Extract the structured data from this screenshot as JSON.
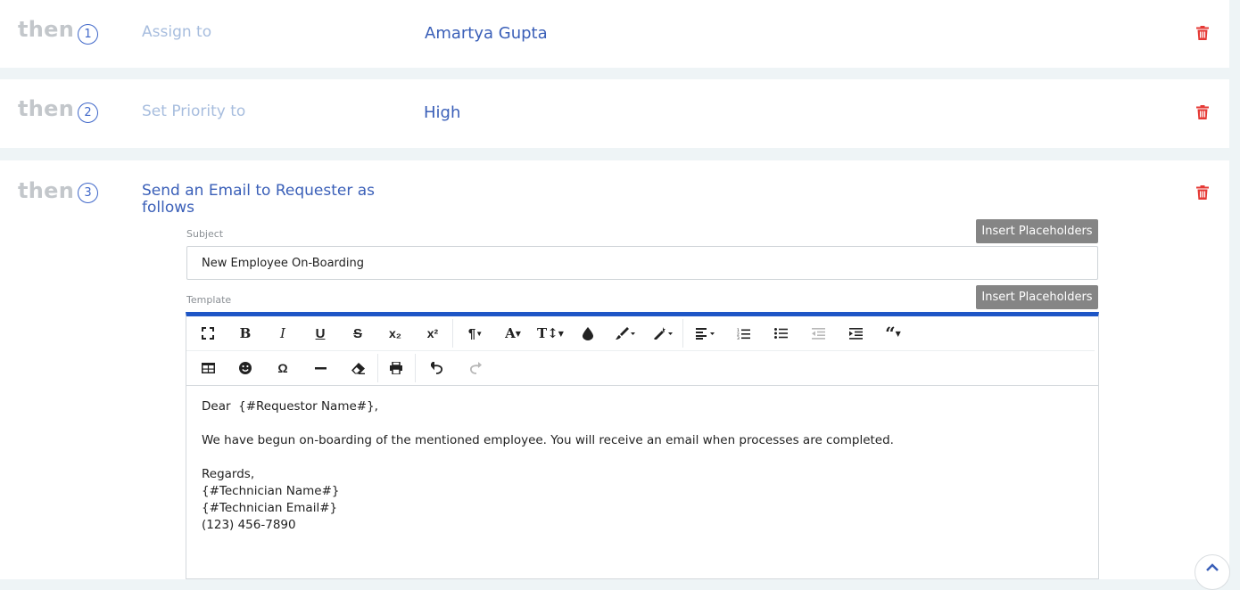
{
  "rules": [
    {
      "then": "then",
      "num": "1",
      "label": "Assign to",
      "value": "Amartya Gupta"
    },
    {
      "then": "then",
      "num": "2",
      "label": "Set Priority to",
      "value": "High"
    },
    {
      "then": "then",
      "num": "3",
      "label_line1": "Send an Email to Requester as",
      "label_line2": "follows"
    }
  ],
  "email": {
    "subject_label": "Subject",
    "subject_value": "New Employee On-Boarding",
    "template_label": "Template",
    "insert_placeholders": "Insert Placeholders",
    "body_lines": [
      "Dear  {#Requestor Name#},",
      "",
      "We have begun on-boarding of the mentioned employee. You will receive an email when processes are completed.",
      "",
      "Regards,",
      "{#Technician Name#}",
      "{#Technician Email#}",
      "(123) 456-7890"
    ]
  },
  "colors": {
    "accent": "#3a5fb8",
    "delete": "#e53935",
    "editor_top_border": "#1e56c6",
    "button_gray": "#858585"
  },
  "icons": {
    "delete": "trash-icon",
    "fullscreen": "fullscreen-icon",
    "scroll": "chevron-up-icon"
  }
}
